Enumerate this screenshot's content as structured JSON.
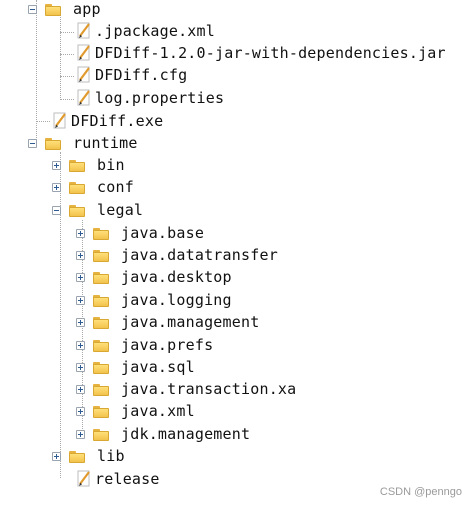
{
  "tree": {
    "app": "app",
    "app_children": [
      ".jpackage.xml",
      "DFDiff-1.2.0-jar-with-dependencies.jar",
      "DFDiff.cfg",
      "log.properties"
    ],
    "exe": "DFDiff.exe",
    "runtime": "runtime",
    "bin": "bin",
    "conf": "conf",
    "legal": "legal",
    "legal_children": [
      "java.base",
      "java.datatransfer",
      "java.desktop",
      "java.logging",
      "java.management",
      "java.prefs",
      "java.sql",
      "java.transaction.xa",
      "java.xml",
      "jdk.management"
    ],
    "lib": "lib",
    "release": "release"
  },
  "icons": {
    "folder": "folder-icon",
    "file": "text-file-icon",
    "expand": "expand-plus-icon",
    "collapse": "collapse-minus-icon"
  },
  "colors": {
    "folder_yellow": "#f2c24c",
    "expander_blue": "#2d5b92",
    "connector_gray": "#a9a9a9"
  },
  "watermark": "CSDN @penngo"
}
